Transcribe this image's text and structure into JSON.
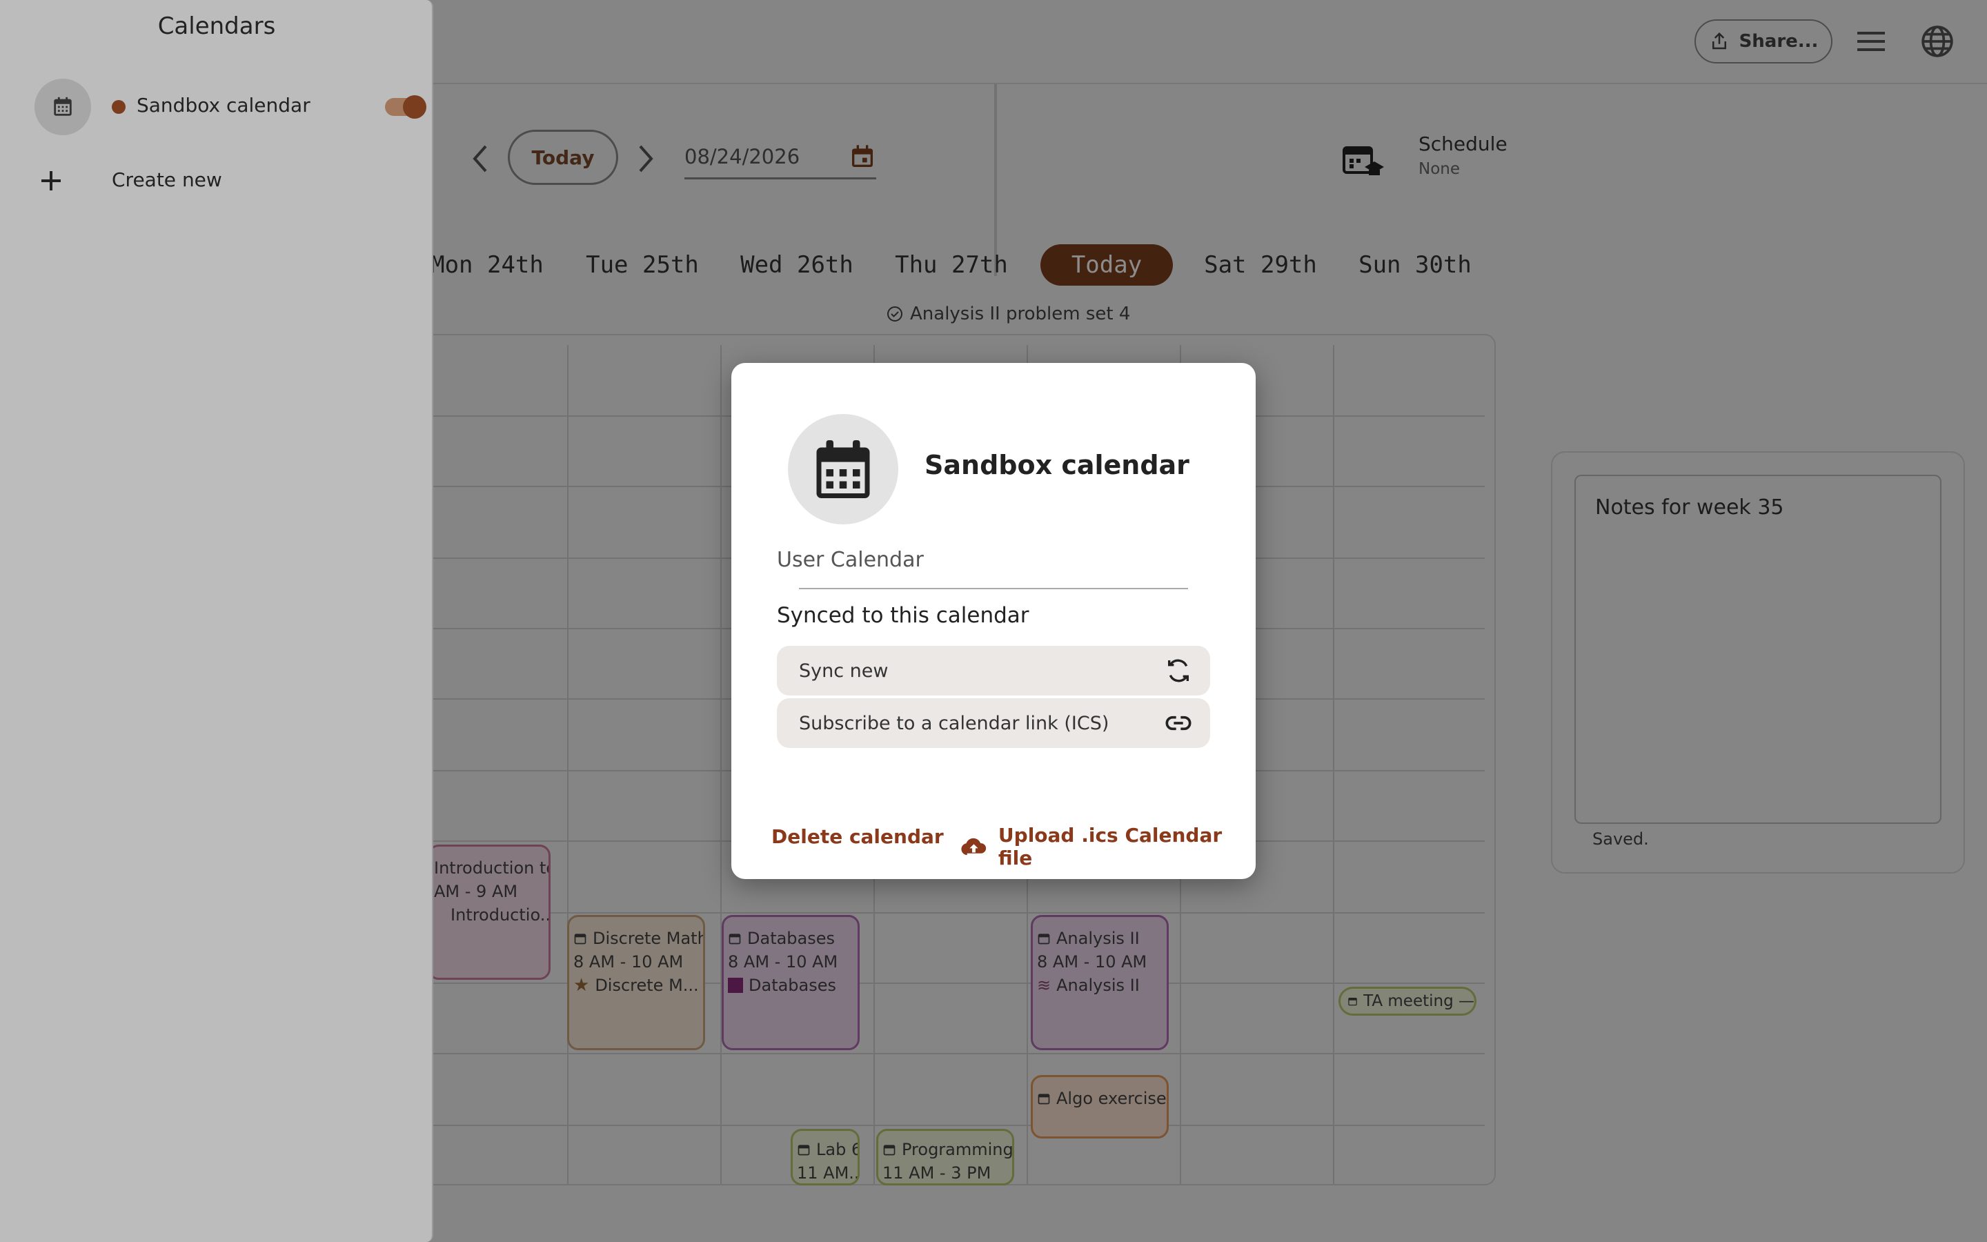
{
  "header": {
    "share_label": "Share...",
    "menu_icon": "menu-icon",
    "language_icon": "globe-icon"
  },
  "toolbar": {
    "today_label": "Today",
    "date_value": "08/24/2026",
    "schedule_title": "Schedule",
    "schedule_value": "None"
  },
  "week": {
    "days": [
      "Mon 24th",
      "Tue 25th",
      "Wed 26th",
      "Thu 27th",
      "Today",
      "Sat 29th",
      "Sun 30th"
    ],
    "task": "Analysis II problem set 4"
  },
  "events": [
    {
      "title": "Introduction to",
      "time": "AM - 9 AM",
      "course": "Introductio..."
    },
    {
      "title": "Discrete Mathe",
      "time": "8 AM - 10 AM",
      "course": "Discrete M..."
    },
    {
      "title": "Databases",
      "time": "8 AM - 10 AM",
      "course": "Databases"
    },
    {
      "title": "Analysis II",
      "time": "8 AM - 10 AM",
      "course": "Analysis II"
    },
    {
      "title": "Algo exercise s"
    },
    {
      "title": "TA meeting —"
    },
    {
      "title": "Lab 6",
      "time": "11 AM..."
    },
    {
      "title": "Programming I",
      "time": "11 AM - 3 PM"
    }
  ],
  "notes": {
    "text": "Notes for week 35",
    "status": "Saved."
  },
  "sidepanel": {
    "title": "Calendars",
    "calendar_name": "Sandbox calendar",
    "create_label": "Create new"
  },
  "modal": {
    "title": "Sandbox calendar",
    "subtitle": "User Calendar",
    "section_title": "Synced to this calendar",
    "sync_label": "Sync new",
    "subscribe_label": "Subscribe to a calendar link (ICS)",
    "delete_label": "Delete calendar",
    "upload_label": "Upload .ics Calendar file"
  },
  "colors": {
    "accent": "#7a3e1e",
    "action_text": "#8a3a1a"
  }
}
